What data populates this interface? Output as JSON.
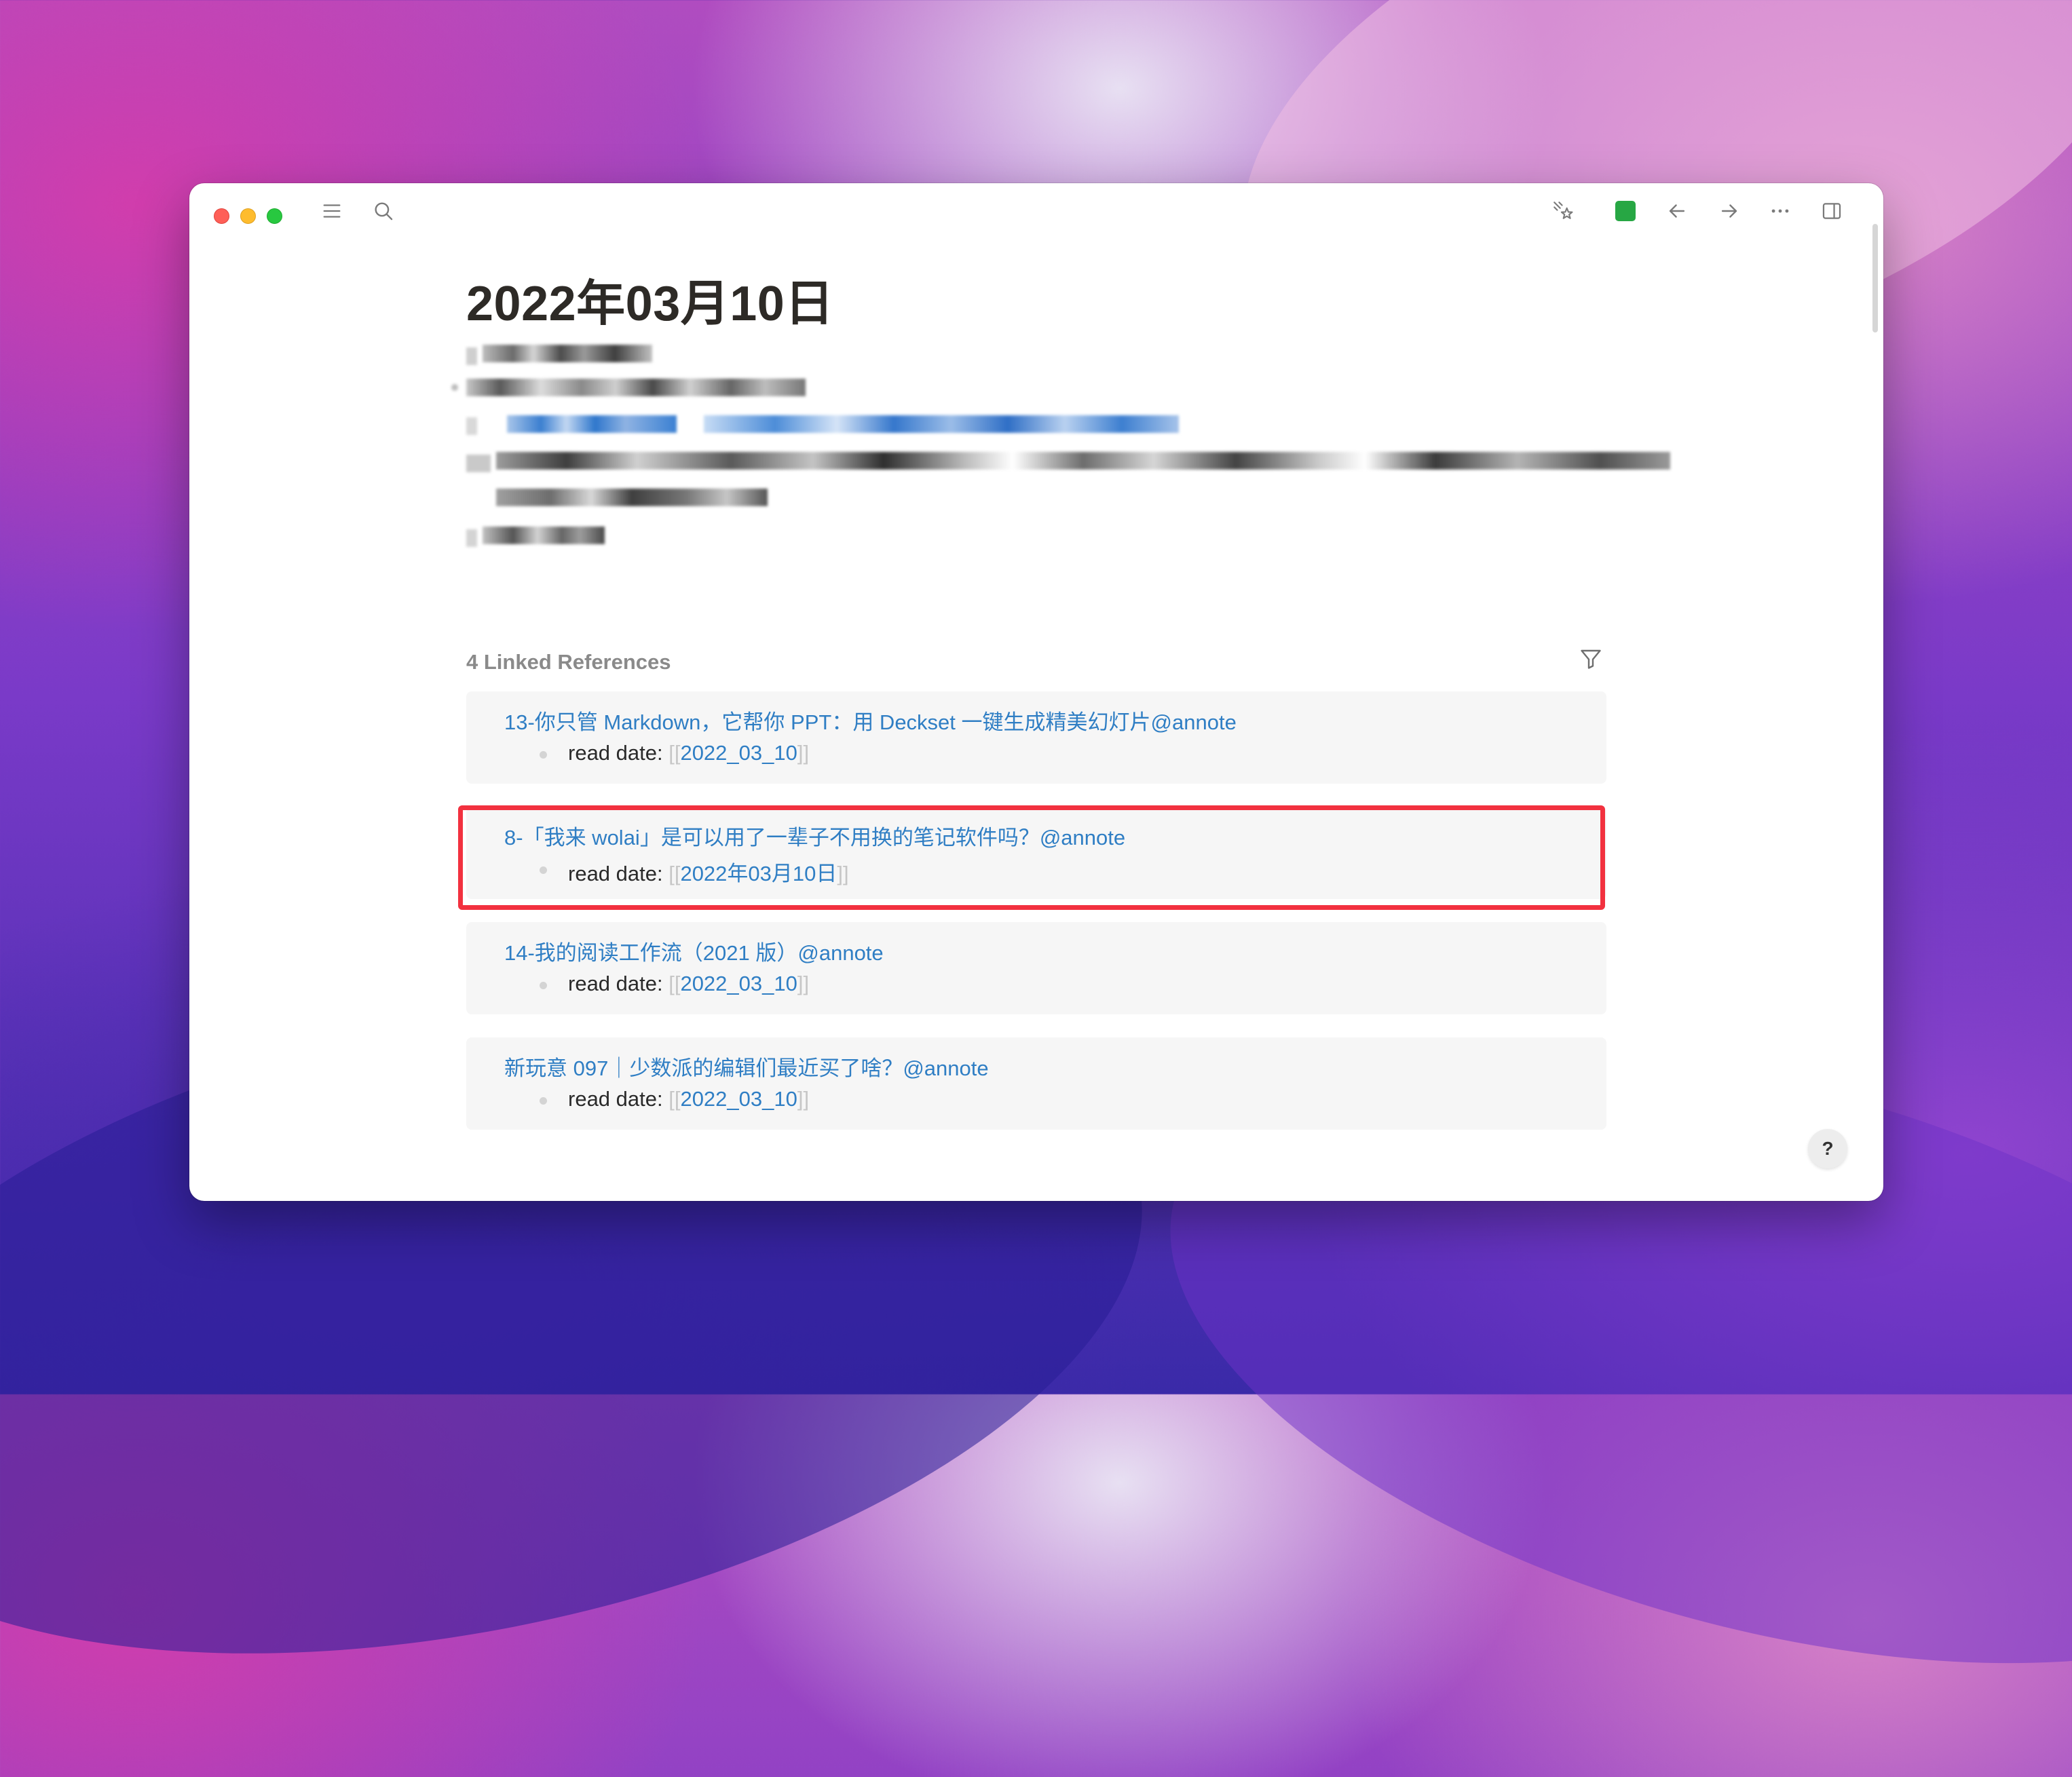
{
  "window": {
    "toolbar": {
      "icons": [
        "sidebar-menu-icon",
        "search-icon",
        "star-sparkle-icon",
        "sync-status-icon",
        "back-arrow-icon",
        "forward-arrow-icon",
        "more-icon",
        "right-sidebar-icon"
      ],
      "sync_color": "#27a744"
    }
  },
  "page": {
    "title": "2022年03月10日"
  },
  "linked_references": {
    "header": "4 Linked References",
    "items": [
      {
        "title": "13-你只管 Markdown，它帮你 PPT：用 Deckset 一键生成精美幻灯片@annote",
        "prop_label": "read date: ",
        "bracket_open": "[[",
        "link": "2022_03_10",
        "bracket_close": "]]"
      },
      {
        "title": "8-「我来 wolai」是可以用了一辈子不用换的笔记软件吗？@annote",
        "prop_label": "read date: ",
        "bracket_open": "[[",
        "link": "2022年03月10日",
        "bracket_close": "]]"
      },
      {
        "title": "14-我的阅读工作流（2021 版）@annote",
        "prop_label": "read date: ",
        "bracket_open": "[[",
        "link": "2022_03_10",
        "bracket_close": "]]"
      },
      {
        "title": "新玩意 097｜少数派的编辑们最近买了啥？@annote",
        "prop_label": "read date: ",
        "bracket_open": "[[",
        "link": "2022_03_10",
        "bracket_close": "]]"
      }
    ]
  },
  "help_button": {
    "label": "?"
  },
  "colors": {
    "accent_link": "#2f7ec4",
    "highlight_border": "#f2313f"
  }
}
